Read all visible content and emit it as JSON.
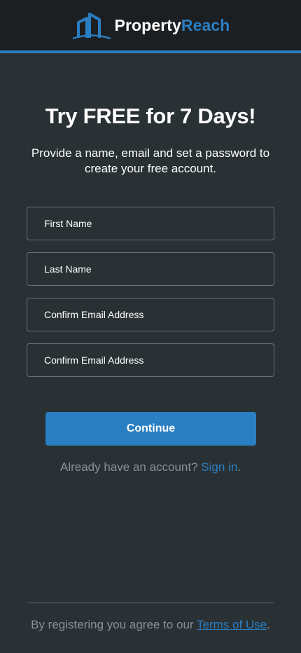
{
  "header": {
    "brand_part1": "Property",
    "brand_part2": "Reach",
    "logo_icon": "building-logo-icon"
  },
  "colors": {
    "accent": "#2a7ec2",
    "background": "#2a3135",
    "header_bg": "#1c1f22"
  },
  "main": {
    "title": "Try FREE for 7 Days!",
    "subtitle": "Provide a name, email and set a password to create your free account."
  },
  "form": {
    "first_name_placeholder": "First Name",
    "last_name_placeholder": "Last Name",
    "email_placeholder": "Confirm Email Address",
    "confirm_email_placeholder": "Confirm Email Address",
    "continue_label": "Continue"
  },
  "signin": {
    "prompt": "Already have an account? ",
    "link": "Sign in",
    "suffix": "."
  },
  "footer": {
    "prefix": "By registering you agree to our ",
    "terms_link": "Terms of Use",
    "suffix": "."
  }
}
